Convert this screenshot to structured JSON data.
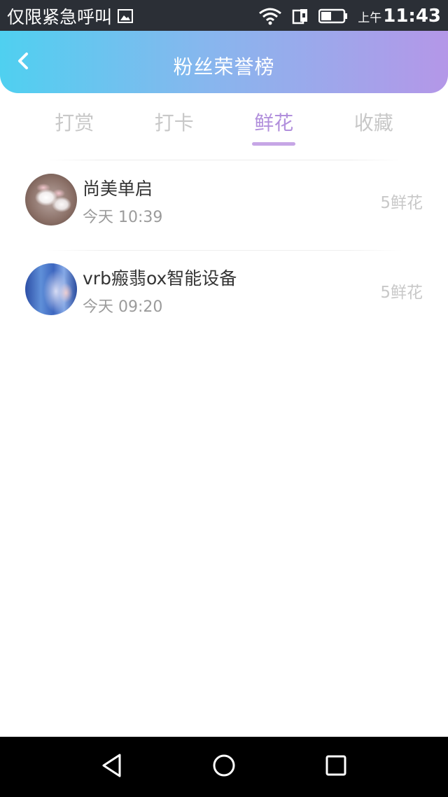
{
  "status_bar": {
    "carrier_text": "仅限紧急呼叫",
    "clock_ampm": "上午",
    "clock_time": "11:43",
    "icons": [
      "gallery-icon",
      "wifi-icon",
      "sim-icon",
      "battery-icon"
    ]
  },
  "header": {
    "title": "粉丝荣誉榜",
    "back_icon": "chevron-left-icon"
  },
  "tabs": [
    {
      "label": "打赏",
      "active": false
    },
    {
      "label": "打卡",
      "active": false
    },
    {
      "label": "鲜花",
      "active": true
    },
    {
      "label": "收藏",
      "active": false
    }
  ],
  "list": [
    {
      "name": "尚美单启",
      "time": "今天 10:39",
      "count": "5鲜花",
      "avatar": "rabbit-photo"
    },
    {
      "name": "vrb瘢翡ox智能设备",
      "time": "今天 09:20",
      "count": "5鲜花",
      "avatar": "forest-photo"
    }
  ],
  "nav_bar": {
    "icons": [
      "back-triangle-icon",
      "home-circle-icon",
      "recents-square-icon"
    ]
  },
  "colors": {
    "accent": "#b18fdc",
    "header_gradient_start": "#4fd0f0",
    "header_gradient_end": "#b497e8"
  }
}
